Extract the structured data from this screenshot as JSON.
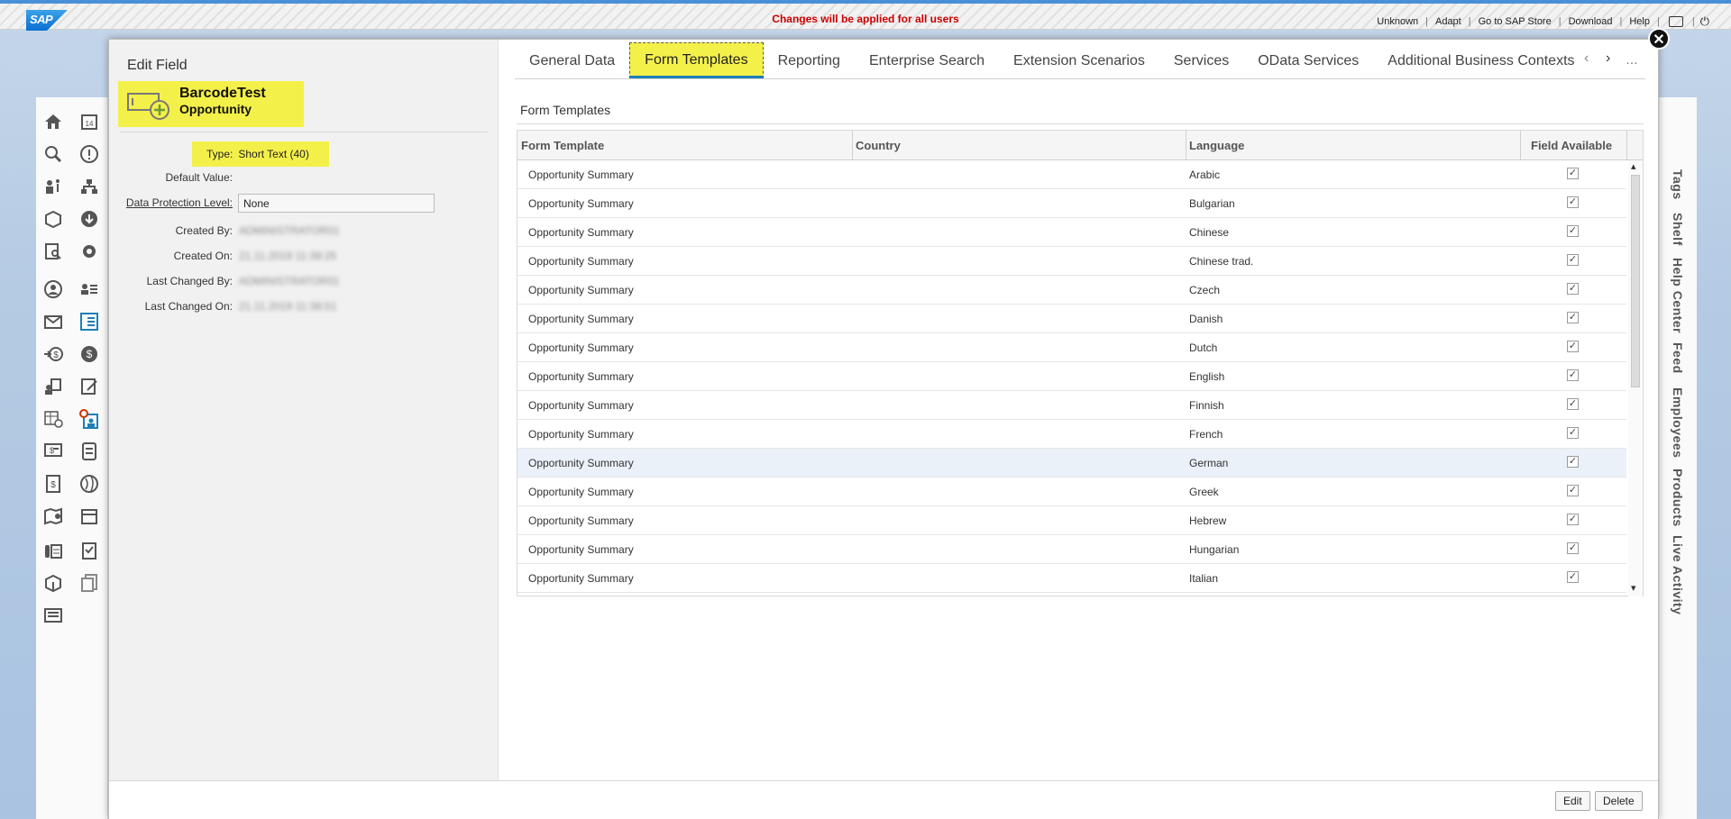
{
  "shell": {
    "logo": "SAP",
    "notice": "Changes will be applied for all users",
    "links": [
      "Unknown",
      "Adapt",
      "Go to SAP Store",
      "Download",
      "Help"
    ]
  },
  "side_panel": [
    "Tags",
    "Shelf",
    "Help Center",
    "Feed",
    "Employees",
    "Products",
    "Live Activity"
  ],
  "dialog": {
    "title": "Edit Field",
    "field_name": "BarcodeTest",
    "field_object": "Opportunity",
    "type_label": "Type:",
    "type_value": "Short Text (40)",
    "props": {
      "default_value_label": "Default Value:",
      "dpl_label": "Data Protection Level:",
      "dpl_value": "None",
      "created_by_label": "Created By:",
      "created_by_value": "ADMINISTRATOR01",
      "created_on_label": "Created On:",
      "created_on_value": "21.11.2019 11:38:25",
      "changed_by_label": "Last Changed By:",
      "changed_by_value": "ADMINISTRATOR01",
      "changed_on_label": "Last Changed On:",
      "changed_on_value": "21.11.2019 11:38:51"
    },
    "tabs": [
      "General Data",
      "Form Templates",
      "Reporting",
      "Enterprise Search",
      "Extension Scenarios",
      "Services",
      "OData Services",
      "Additional Business Contexts"
    ],
    "active_tab": "Form Templates",
    "section_title": "Form Templates",
    "table": {
      "columns": [
        "Form Template",
        "Country",
        "Language",
        "Field Available"
      ],
      "rows": [
        {
          "template": "Opportunity Summary",
          "country": "",
          "language": "Arabic",
          "available": true
        },
        {
          "template": "Opportunity Summary",
          "country": "",
          "language": "Bulgarian",
          "available": true
        },
        {
          "template": "Opportunity Summary",
          "country": "",
          "language": "Chinese",
          "available": true
        },
        {
          "template": "Opportunity Summary",
          "country": "",
          "language": "Chinese trad.",
          "available": true
        },
        {
          "template": "Opportunity Summary",
          "country": "",
          "language": "Czech",
          "available": true
        },
        {
          "template": "Opportunity Summary",
          "country": "",
          "language": "Danish",
          "available": true
        },
        {
          "template": "Opportunity Summary",
          "country": "",
          "language": "Dutch",
          "available": true
        },
        {
          "template": "Opportunity Summary",
          "country": "",
          "language": "English",
          "available": true
        },
        {
          "template": "Opportunity Summary",
          "country": "",
          "language": "Finnish",
          "available": true
        },
        {
          "template": "Opportunity Summary",
          "country": "",
          "language": "French",
          "available": true
        },
        {
          "template": "Opportunity Summary",
          "country": "",
          "language": "German",
          "available": true,
          "selected": true
        },
        {
          "template": "Opportunity Summary",
          "country": "",
          "language": "Greek",
          "available": true
        },
        {
          "template": "Opportunity Summary",
          "country": "",
          "language": "Hebrew",
          "available": true
        },
        {
          "template": "Opportunity Summary",
          "country": "",
          "language": "Hungarian",
          "available": true
        },
        {
          "template": "Opportunity Summary",
          "country": "",
          "language": "Italian",
          "available": true
        }
      ]
    },
    "buttons": {
      "edit": "Edit",
      "delete": "Delete"
    }
  },
  "colors": {
    "highlight": "#f4f04a",
    "accent": "#1d7fb8",
    "notice": "#cc0000"
  }
}
